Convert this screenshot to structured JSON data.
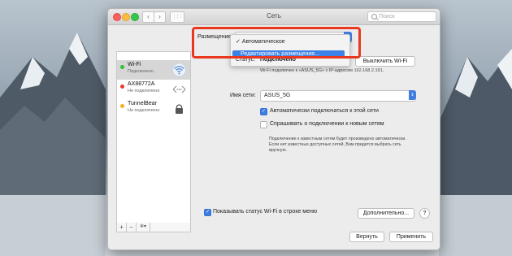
{
  "window": {
    "title": "Сеть",
    "search_placeholder": "Поиск",
    "back_glyph": "‹",
    "forward_glyph": "›",
    "grid_glyph": "⋮⋮⋮"
  },
  "location": {
    "label": "Размещение",
    "menu_items": [
      {
        "label": "✓ Автоматическое"
      },
      {
        "label": "Редактировать размещения..."
      }
    ]
  },
  "services": [
    {
      "name": "Wi-Fi",
      "status": "Подключено",
      "dot_color": "#2fc23a",
      "icon": "wifi-icon"
    },
    {
      "name": "AX88772A",
      "status": "Не подключено",
      "dot_color": "#e8392d",
      "icon": "ethernet-icon"
    },
    {
      "name": "TunnelBear",
      "status": "Не подключено",
      "dot_color": "#f2b01e",
      "icon": "vpn-lock-icon"
    }
  ],
  "sidebar_buttons": {
    "add": "+",
    "remove": "−",
    "action": "✲▾"
  },
  "detail": {
    "status_label": "Статус:",
    "status_value": "Подключено",
    "wifi_off_button": "Выключить Wi-Fi",
    "status_desc": "Wi-Fi подключен к «ASUS_5G» с IP-адресом 192.168.2.191.",
    "network_label": "Имя сети:",
    "network_value": "ASUS_5G",
    "auto_join_label": "Автоматически подключаться к этой сети",
    "auto_join_checked": true,
    "ask_join_label": "Спрашивать о подключении к новым сетям",
    "ask_join_checked": false,
    "note": "Подключение к известным сетям будет произведено автоматически. Если нет известных доступных сетей, Вам придется выбрать сеть вручную.",
    "show_status_label": "Показывать статус Wi-Fi в строке меню",
    "show_status_checked": true,
    "advanced_button": "Дополнительно...",
    "help_button": "?"
  },
  "footer": {
    "revert": "Вернуть",
    "apply": "Применить"
  },
  "colors": {
    "accent": "#3f7de0",
    "highlight_frame": "#e8391f"
  }
}
